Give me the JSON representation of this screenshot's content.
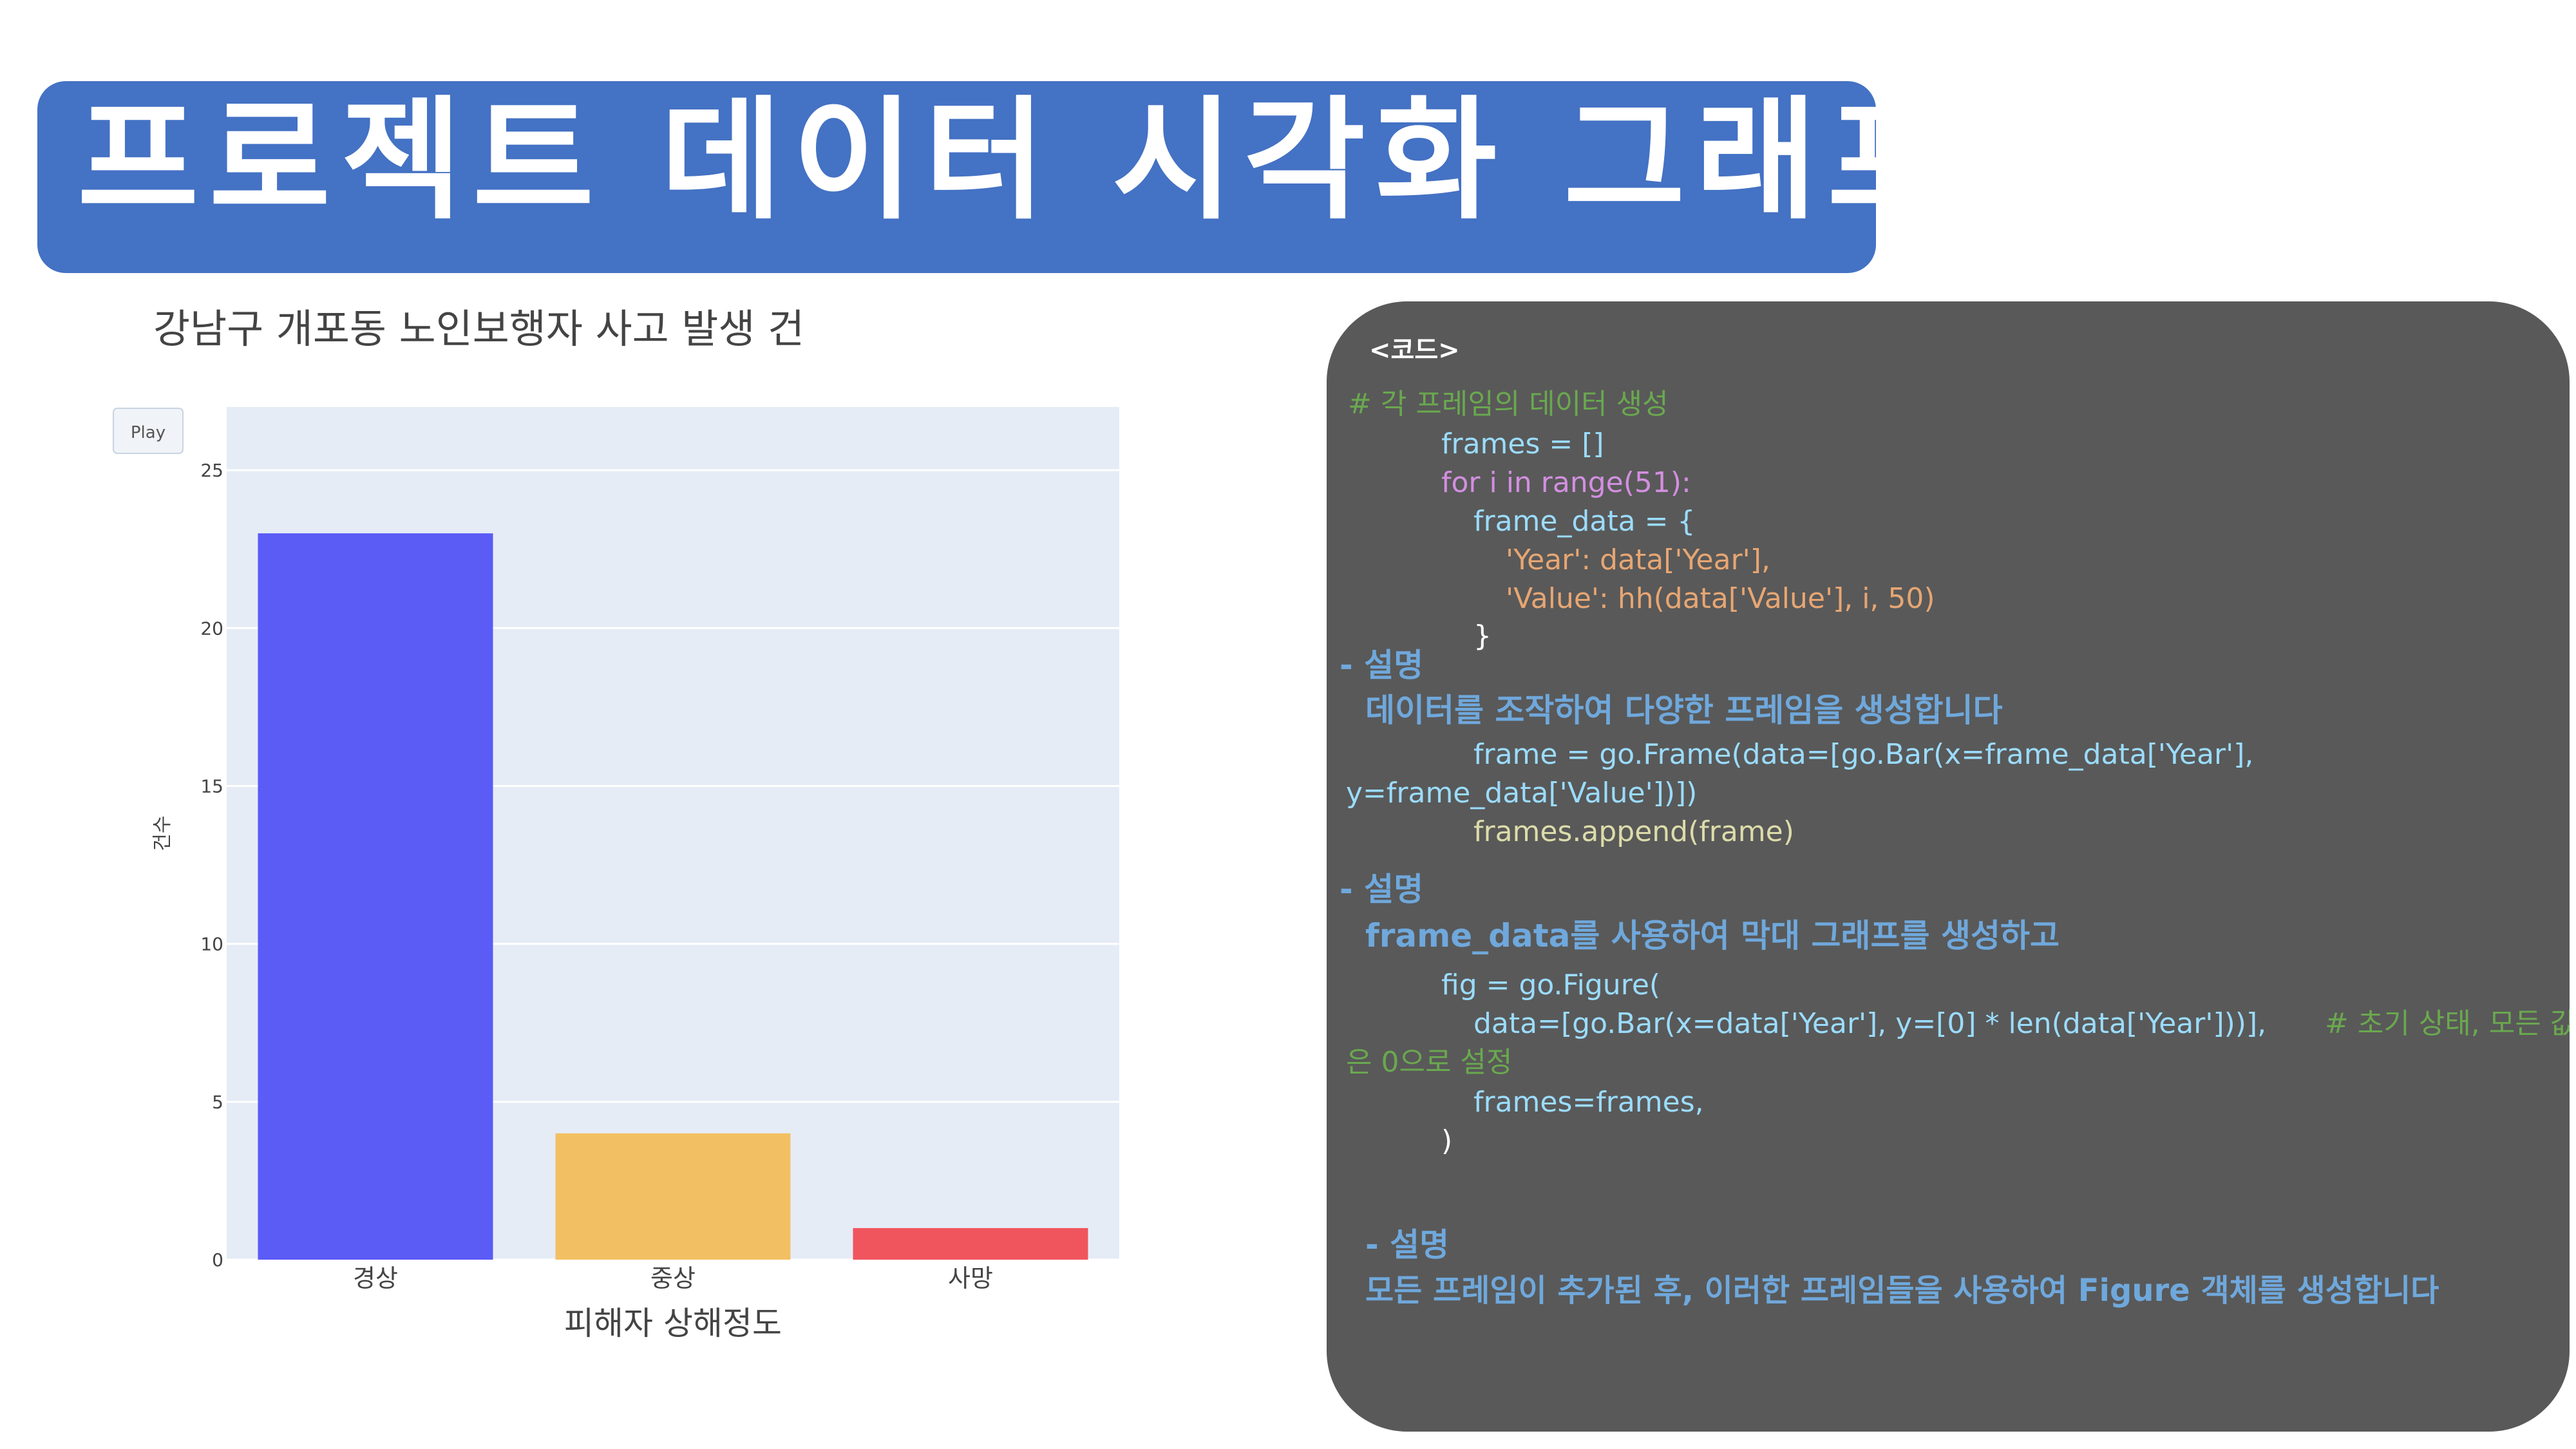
{
  "slide_title": "프로젝트 데이터 시각화 그래프",
  "chart": {
    "title": "강남구 개포동 노인보행자 사고 발생 건",
    "play_button": "Play"
  },
  "chart_data": {
    "type": "bar",
    "title": "강남구 개포동 노인보행자 사고 발생 건",
    "xlabel": "피해자 상해정도",
    "ylabel": "건수",
    "categories": [
      "경상",
      "중상",
      "사망"
    ],
    "values": [
      23,
      4,
      1
    ],
    "colors": [
      "#5b5bf6",
      "#f2c063",
      "#f0555e"
    ],
    "ylim": [
      0,
      27
    ],
    "yticks": [
      0,
      5,
      10,
      15,
      20,
      25
    ],
    "grid": true,
    "plot_background": "#e5ecf6"
  },
  "code_panel": {
    "heading": "<코드>",
    "comment1": "# 각 프레임의 데이터 생성",
    "line_frames": "frames = []",
    "line_for": "for i in range(51):",
    "line_frame_data": "frame_data = {",
    "line_year": "'Year': data['Year'],",
    "line_value": "'Value': hh(data['Value'], i, 50)",
    "line_close_brace": "}",
    "desc1_title": "- 설명",
    "desc1_text": "데이터를 조작하여 다양한 프레임을 생성합니다",
    "line_frame1": "frame = go.Frame(data=[go.Bar(x=frame_data['Year'],",
    "line_frame2": "y=frame_data['Value'])])",
    "line_append": "frames.append(frame)",
    "desc2_title": "- 설명",
    "desc2_text": "frame_data를 사용하여 막대 그래프를 생성하고",
    "line_fig": "fig = go.Figure(",
    "line_fig_data": "data=[go.Bar(x=data['Year'], y=[0] * len(data['Year']))],",
    "line_fig_comment": "# 초기 상태, 모든 값",
    "line_fig_comment2": "은 0으로 설정",
    "line_fig_frames": "frames=frames,",
    "line_fig_close": ")",
    "desc3_title": "- 설명",
    "desc3_text": "모든 프레임이 추가된 후, 이러한 프레임들을 사용하여 Figure 객체를 생성합니다"
  }
}
